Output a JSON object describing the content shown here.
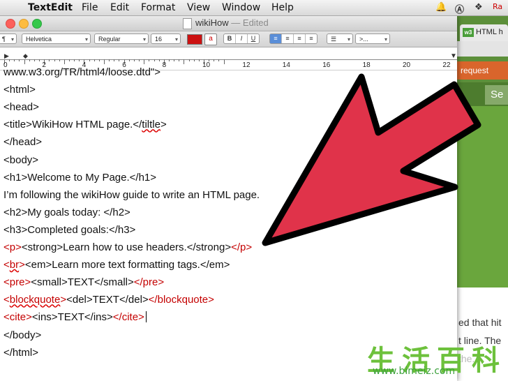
{
  "menubar": {
    "app": "TextEdit",
    "items": [
      "File",
      "Edit",
      "Format",
      "View",
      "Window",
      "Help"
    ],
    "tray_text": "Ra"
  },
  "browser": {
    "tab_badge": "w3",
    "tab_label": "HTML h",
    "orange_bar": "request",
    "se_text": "Se",
    "text_lines": [
      "ed that hit",
      "t line. The",
      "the..."
    ]
  },
  "window": {
    "doc_title": "wikiHow",
    "doc_state": "— Edited",
    "toolbar": {
      "font_family": "Helvetica",
      "font_style": "Regular",
      "font_size": "16",
      "text_color_glyph": "a",
      "style_buttons": [
        "B",
        "I",
        "U"
      ],
      "list_button": ">... ",
      "text_color_hex": "#cc1111"
    },
    "ruler_numbers": [
      "0",
      "2",
      "4",
      "6",
      "8",
      "10",
      "12",
      "14",
      "16",
      "18",
      "20",
      "22"
    ]
  },
  "document": {
    "lines": [
      [
        {
          "t": "   www.w3.org/TR/html4/loose.dtd\">",
          "c": "k"
        }
      ],
      [
        {
          "t": "<html>",
          "c": "k"
        }
      ],
      [
        {
          "t": "<head>",
          "c": "k"
        }
      ],
      [
        {
          "t": "<title>WikiHow HTML page.</",
          "c": "k"
        },
        {
          "t": "tiltle",
          "c": "sq"
        },
        {
          "t": ">",
          "c": "k"
        }
      ],
      [
        {
          "t": "</head>",
          "c": "k"
        }
      ],
      [
        {
          "t": "<body>",
          "c": "k"
        }
      ],
      [
        {
          "t": "<h1>Welcome to My Page.</h1>",
          "c": "k"
        }
      ],
      [
        {
          "t": "I’m following the wikiHow guide to write an HTML page.",
          "c": "k"
        }
      ],
      [
        {
          "t": "<h2>My goals today: </h2>",
          "c": "k"
        }
      ],
      [
        {
          "t": "<h3>Completed goals:</h3>",
          "c": "k"
        }
      ],
      [
        {
          "t": "<p>",
          "c": "r"
        },
        {
          "t": "<strong>Learn how to use headers.</strong>",
          "c": "k"
        },
        {
          "t": "</p>",
          "c": "r"
        }
      ],
      [
        {
          "t": "<",
          "c": "r"
        },
        {
          "t": "br",
          "c": "rsq"
        },
        {
          "t": ">",
          "c": "r"
        },
        {
          "t": "<em>Learn more text formatting tags.</em>",
          "c": "k"
        }
      ],
      [
        {
          "t": "<pre>",
          "c": "r"
        },
        {
          "t": "<small>TEXT</small>",
          "c": "k"
        },
        {
          "t": "</pre>",
          "c": "r"
        }
      ],
      [
        {
          "t": "<",
          "c": "r"
        },
        {
          "t": "blockquote",
          "c": "rsq"
        },
        {
          "t": ">",
          "c": "r"
        },
        {
          "t": "<del>TEXT</del>",
          "c": "k"
        },
        {
          "t": "</blockquote>",
          "c": "r"
        }
      ],
      [
        {
          "t": "<cite>",
          "c": "r"
        },
        {
          "t": "<ins>TEXT</ins>",
          "c": "k"
        },
        {
          "t": "</cite>",
          "c": "r"
        },
        {
          "t": "",
          "c": "caret"
        }
      ],
      [
        {
          "t": "</body>",
          "c": "k"
        }
      ],
      [
        {
          "t": "</html>",
          "c": "k"
        }
      ]
    ]
  },
  "watermark": {
    "chars": "生活百科",
    "url": "www.bimeiz.com"
  },
  "colors": {
    "arrow_fill": "#e0334a",
    "arrow_stroke": "#000000",
    "tag_red": "#c40000"
  }
}
